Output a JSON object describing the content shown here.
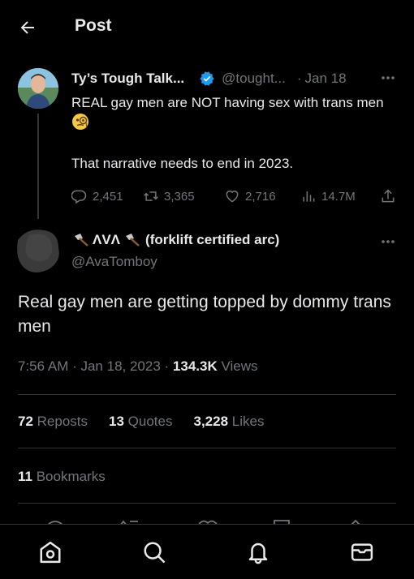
{
  "header": {
    "title": "Post"
  },
  "parent_tweet": {
    "name": "Ty’s Tough Talk...",
    "handle": "@tought...",
    "separator": "·",
    "date": "Jan 18",
    "text_line1": "REAL gay men are NOT having sex with trans men",
    "text_line2": "That narrative needs to end in 2023.",
    "emoji": "face-with-monocle",
    "replies": "2,451",
    "reposts": "3,365",
    "likes": "2,716",
    "views": "14.7M"
  },
  "main_tweet": {
    "name": "ΛVΛ (forklift certified arc)",
    "name_prefix": "ΛVΛ",
    "name_suffix": "(forklift certified arc)",
    "handle": "@AvaTomboy",
    "text": "Real gay men are getting topped by dommy trans men",
    "time": "7:56 AM · Jan 18, 2023 · ",
    "views_count": "134.3K",
    "views_label": " Views",
    "reposts_count": "72",
    "reposts_label": " Reposts",
    "quotes_count": "13",
    "quotes_label": " Quotes",
    "likes_count": "3,228",
    "likes_label": " Likes",
    "bookmarks_count": "11",
    "bookmarks_label": " Bookmarks"
  },
  "colors": {
    "background": "#000000",
    "text": "#e7e9ea",
    "muted": "#71767b",
    "verified": "#1d9bf0",
    "divider": "#2f3336"
  },
  "bottom_nav": [
    "home-icon",
    "search-icon",
    "notifications-icon",
    "messages-icon"
  ]
}
